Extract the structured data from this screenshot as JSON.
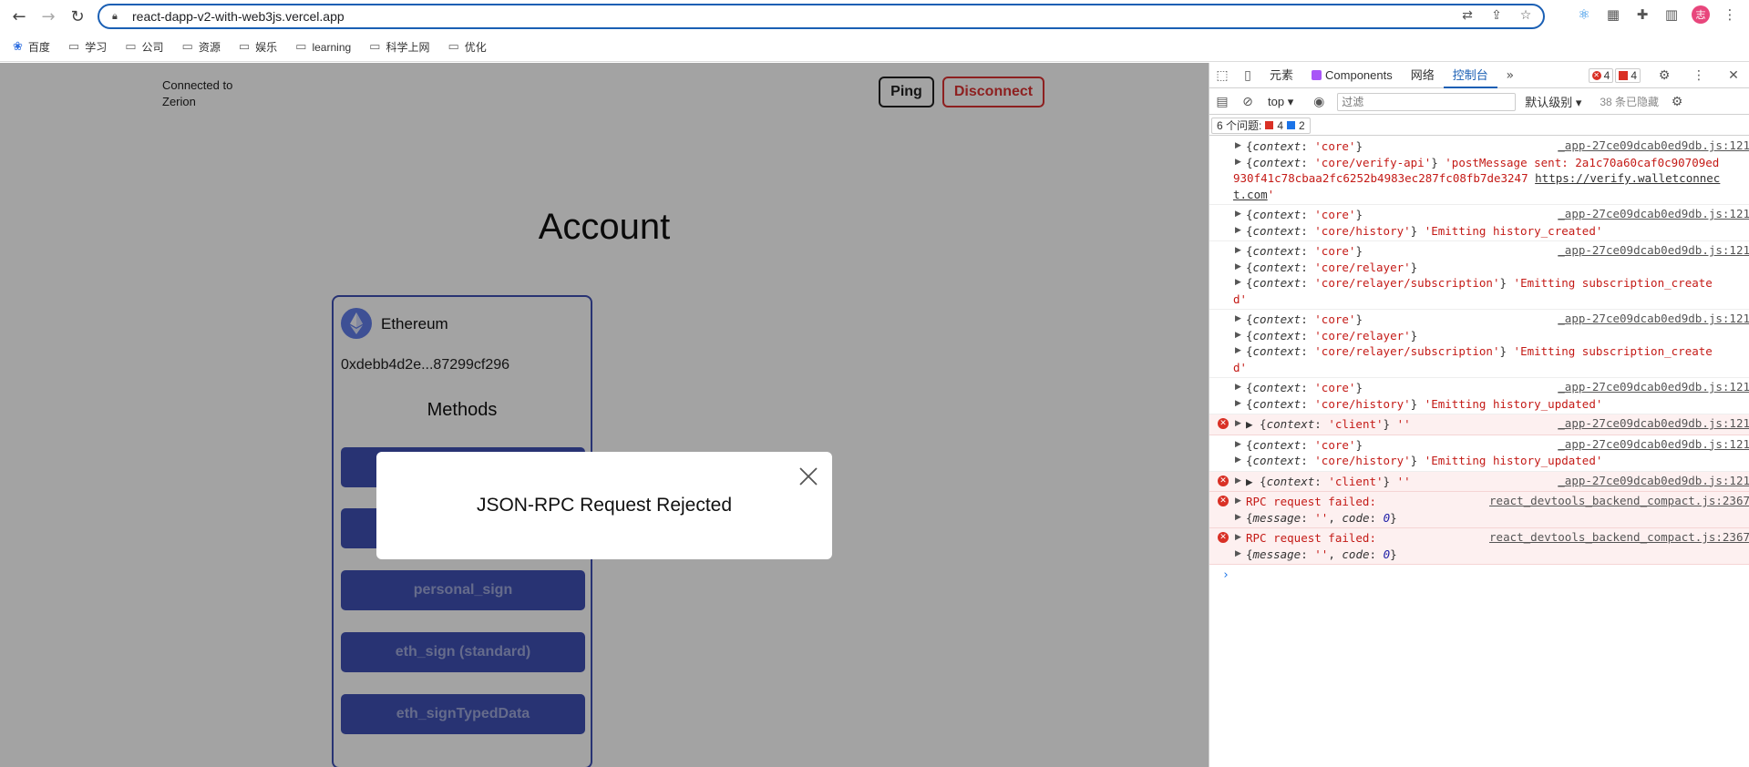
{
  "browser": {
    "url": "react-dapp-v2-with-web3js.vercel.app",
    "avatar_letter": "志",
    "bookmarks": [
      "百度",
      "学习",
      "公司",
      "资源",
      "娱乐",
      "learning",
      "科学上网",
      "优化"
    ]
  },
  "page": {
    "connected_line1": "Connected to",
    "connected_line2": "Zerion",
    "ping_label": "Ping",
    "disconnect_label": "Disconnect",
    "account_title": "Account",
    "chain_name": "Ethereum",
    "address": "0xdebb4d2e...87299cf296",
    "methods_title": "Methods",
    "method_buttons": [
      "",
      "",
      "personal_sign",
      "eth_sign (standard)",
      "eth_signTypedData"
    ],
    "modal_text": "JSON-RPC Request Rejected"
  },
  "devtools": {
    "tabs": [
      "元素",
      "Components",
      "网络",
      "控制台"
    ],
    "active_tab": "控制台",
    "error_count": "4",
    "warn_count": "4",
    "context": "top",
    "filter_placeholder": "过滤",
    "levels": "默认级别",
    "hidden": "38 条已隐藏",
    "issues_label": "6 个问题:",
    "issues_red": "4",
    "issues_blue": "2",
    "source_app": "_app-27ce09dcab0ed9db.js:121",
    "source_react": "react_devtools_backend_compact.js:2367",
    "rpc_failed": "RPC request failed:",
    "verify_msg": "'postMessage sent: 2a1c70a60caf0c90709ed930f41c78cbaa2fc6252b4983ec287fc08fb7de3247 ",
    "verify_link": "https://verify.walletconnect.com",
    "history_created": "'Emitting history_created'",
    "subscription_created": "'Emitting subscription_created'",
    "history_updated": "'Emitting history_updated'"
  },
  "colors": {
    "accent": "#3f51b5",
    "danger": "#dd3333",
    "devtools_blue": "#1a5fb4"
  }
}
